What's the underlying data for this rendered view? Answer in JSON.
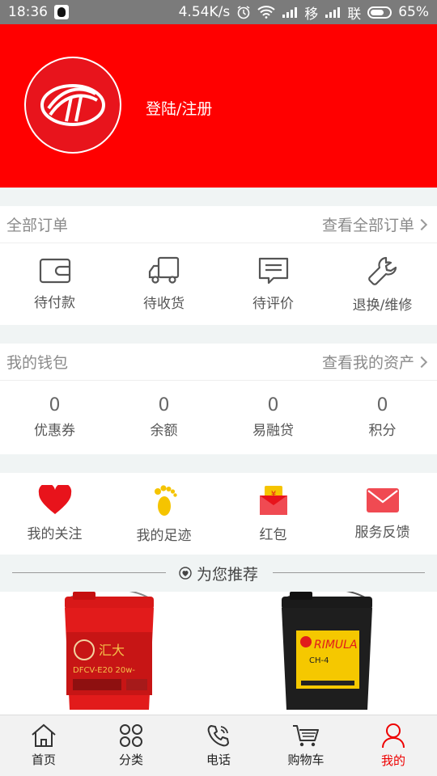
{
  "statusbar": {
    "time": "18:36",
    "speed": "4.54K/s",
    "carrier1": "移",
    "carrier2": "联",
    "battery": "65%"
  },
  "header": {
    "login_label": "登陆/注册"
  },
  "orders": {
    "title": "全部订单",
    "link": "查看全部订单",
    "items": [
      {
        "label": "待付款",
        "icon": "wallet-icon"
      },
      {
        "label": "待收货",
        "icon": "truck-icon"
      },
      {
        "label": "待评价",
        "icon": "comment-icon"
      },
      {
        "label": "退换/维修",
        "icon": "wrench-icon"
      }
    ]
  },
  "wallet": {
    "title": "我的钱包",
    "link": "查看我的资产",
    "items": [
      {
        "value": "0",
        "label": "优惠券"
      },
      {
        "value": "0",
        "label": "余额"
      },
      {
        "value": "0",
        "label": "易融贷"
      },
      {
        "value": "0",
        "label": "积分"
      }
    ]
  },
  "shortcuts": [
    {
      "label": "我的关注",
      "icon": "heart-icon"
    },
    {
      "label": "我的足迹",
      "icon": "footprint-icon"
    },
    {
      "label": "红包",
      "icon": "red-envelope-icon"
    },
    {
      "label": "服务反馈",
      "icon": "mail-icon"
    }
  ],
  "recommend": {
    "title": "为您推荐"
  },
  "tabs": [
    {
      "label": "首页",
      "icon": "home-icon"
    },
    {
      "label": "分类",
      "icon": "category-icon"
    },
    {
      "label": "电话",
      "icon": "phone-icon"
    },
    {
      "label": "购物车",
      "icon": "cart-icon"
    },
    {
      "label": "我的",
      "icon": "user-icon"
    }
  ],
  "colors": {
    "brand_red": "#ff0000",
    "active_tab": "#e00000"
  }
}
